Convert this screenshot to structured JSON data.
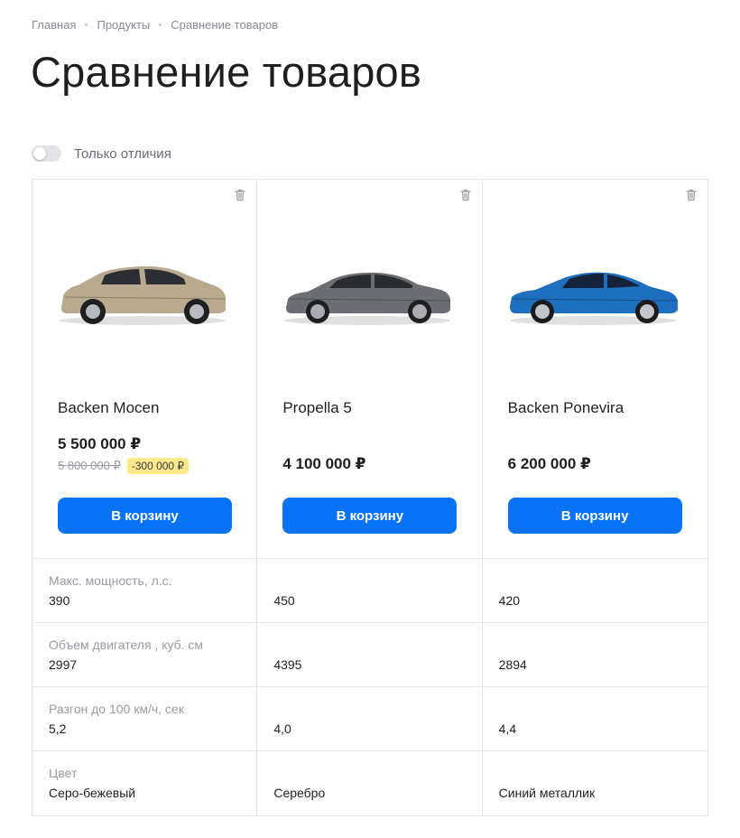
{
  "breadcrumb": [
    "Главная",
    "Продукты",
    "Сравнение товаров"
  ],
  "title": "Сравнение товаров",
  "toggle": {
    "label": "Только отличия",
    "on": false
  },
  "cart_label": "В корзину",
  "products": [
    {
      "name": "Backen Mocen",
      "price": "5 500 000 ₽",
      "old_price": "5 800 000 ₽",
      "discount": "-300 000 ₽",
      "color": "#b9a98e"
    },
    {
      "name": "Propella 5",
      "price": "4 100 000 ₽",
      "color": "#6b6e72"
    },
    {
      "name": "Backen Ponevira",
      "price": "6 200 000 ₽",
      "color": "#1e6fc0"
    }
  ],
  "specs": [
    {
      "label": "Макс. мощность, л.с.",
      "values": [
        "390",
        "450",
        "420"
      ]
    },
    {
      "label": "Объем двигателя , куб. см",
      "values": [
        "2997",
        "4395",
        "2894"
      ]
    },
    {
      "label": "Разгон до 100 км/ч, сек",
      "values": [
        "5,2",
        "4,0",
        "4,4"
      ]
    },
    {
      "label": "Цвет",
      "values": [
        "Серо-бежевый",
        "Серебро",
        "Синий металлик"
      ]
    }
  ],
  "colors": {
    "accent": "#0a73f5",
    "discount_bg": "#fde98a"
  }
}
